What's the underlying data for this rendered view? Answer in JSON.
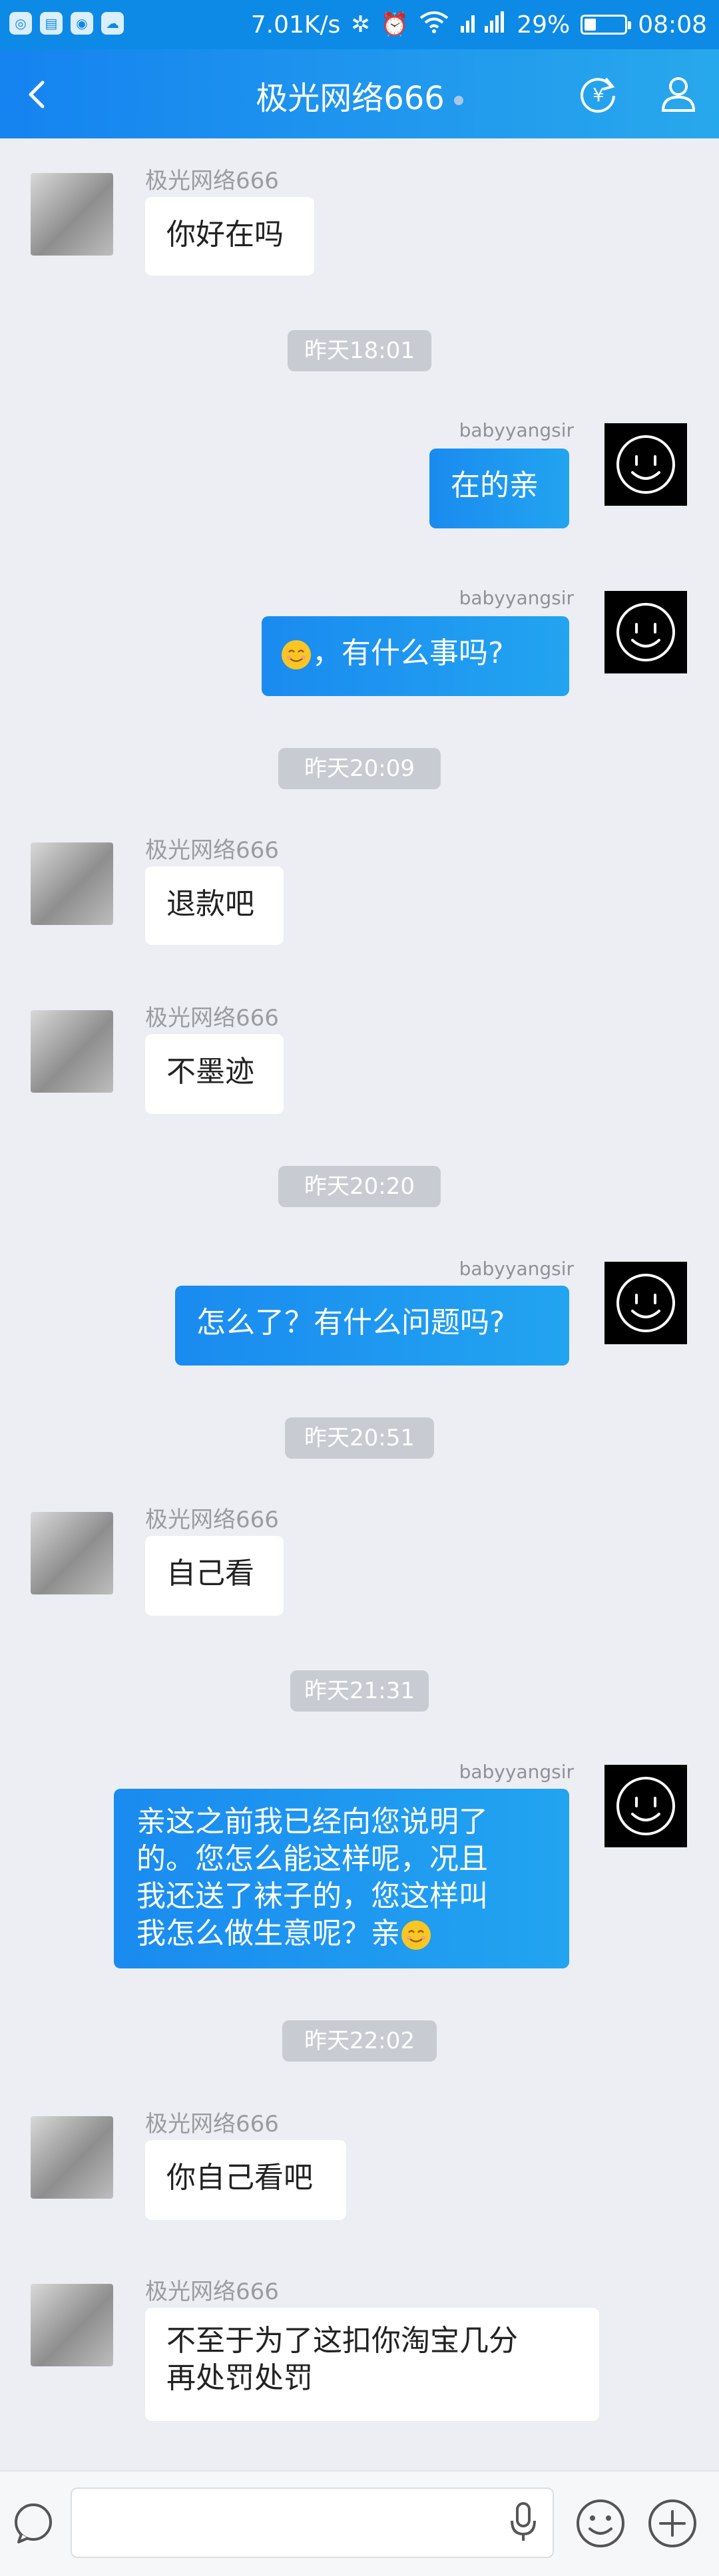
{
  "status_bar": {
    "network_speed": "7.01K/s",
    "battery_percent": "29%",
    "time": "08:08",
    "battery_level": 0.29,
    "app_icons": [
      "weibo-icon",
      "app-icon",
      "wechat-icon",
      "weather-icon"
    ]
  },
  "header": {
    "title": "极光网络666"
  },
  "messages": [
    {
      "side": "left",
      "sender": "极光网络666",
      "text": "你好在吗"
    },
    {
      "type": "time",
      "text": "昨天18:01"
    },
    {
      "side": "right",
      "sender": "babyyangsir",
      "text": "在的亲"
    },
    {
      "side": "right",
      "sender": "babyyangsir",
      "text": "，有什么事吗?"
    },
    {
      "type": "time",
      "text": "昨天20:09"
    },
    {
      "side": "left",
      "sender": "极光网络666",
      "text": "退款吧"
    },
    {
      "side": "left",
      "sender": "极光网络666",
      "text": "不墨迹"
    },
    {
      "type": "time",
      "text": "昨天20:20"
    },
    {
      "side": "right",
      "sender": "babyyangsir",
      "text": "怎么了？有什么问题吗?"
    },
    {
      "type": "time",
      "text": "昨天20:51"
    },
    {
      "side": "left",
      "sender": "极光网络666",
      "text": "自己看"
    },
    {
      "type": "time",
      "text": "昨天21:31"
    },
    {
      "side": "right",
      "sender": "babyyangsir",
      "text_lines": [
        "亲这之前我已经向您说明了",
        "的。您怎么能这样呢，况且",
        "我还送了袜子的，您这样叫",
        "我怎么做生意呢？亲"
      ]
    },
    {
      "type": "time",
      "text": "昨天22:02"
    },
    {
      "side": "left",
      "sender": "极光网络666",
      "text": "你自己看吧"
    },
    {
      "side": "left",
      "sender": "极光网络666",
      "text_lines": [
        "不至于为了这扣你淘宝几分",
        "再处罚处罚"
      ]
    }
  ],
  "input_bar": {
    "placeholder": ""
  },
  "colors": {
    "header_start": "#1583f0",
    "header_end": "#28a8ec",
    "bubble_right": "#1a8bf0",
    "background": "#eceef3"
  }
}
